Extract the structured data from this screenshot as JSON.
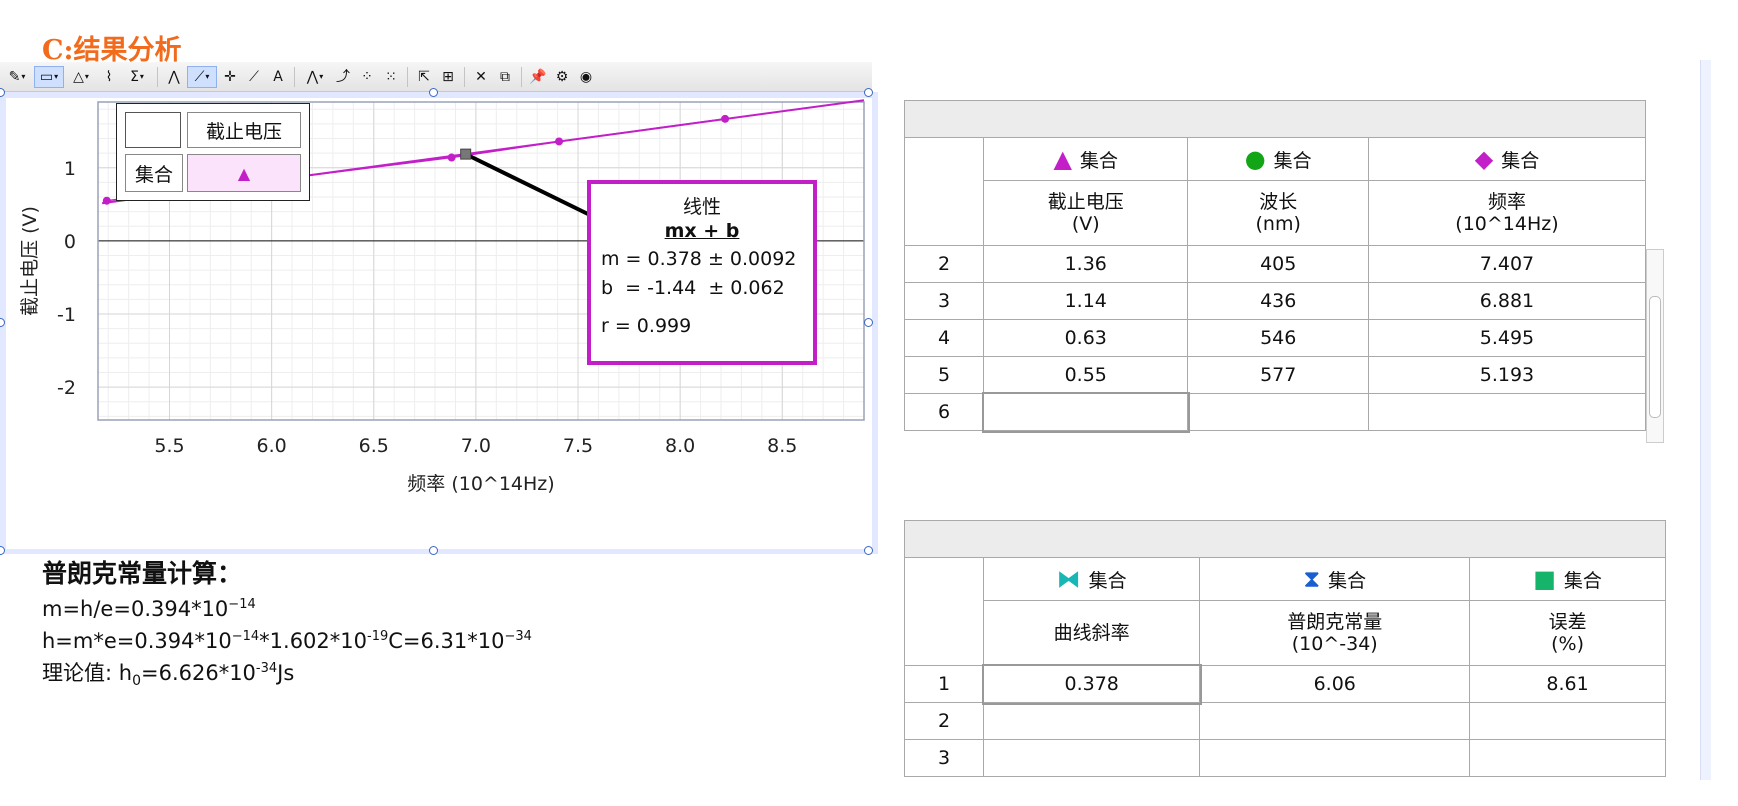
{
  "section_title": "C:结果分析",
  "toolbar": {
    "buttons": [
      {
        "name": "table-options-icon",
        "glyph": "✎",
        "dropdown": true
      },
      {
        "name": "insert-icon",
        "glyph": "▭",
        "dropdown": true,
        "active": true
      },
      {
        "name": "graph-options-icon",
        "glyph": "△",
        "dropdown": true
      },
      {
        "name": "statistics-icon",
        "glyph": "⌇",
        "dropdown": false
      },
      {
        "name": "sigma-icon",
        "glyph": "Σ",
        "dropdown": true
      },
      {
        "name": "integral-icon",
        "glyph": "⋀",
        "dropdown": false
      },
      {
        "name": "linear-fit-icon",
        "glyph": "⟋",
        "dropdown": true,
        "active": true
      },
      {
        "name": "examine-icon",
        "glyph": "✛",
        "dropdown": false
      },
      {
        "name": "tangent-icon",
        "glyph": "⟋",
        "dropdown": false
      },
      {
        "name": "annotation-icon",
        "glyph": "A",
        "dropdown": false
      },
      {
        "name": "fft-icon",
        "glyph": "⋀",
        "dropdown": true
      },
      {
        "name": "curve-fit-icon",
        "glyph": "⤴",
        "dropdown": false
      },
      {
        "name": "connect-points-icon",
        "glyph": "⁘",
        "dropdown": false
      },
      {
        "name": "disconnect-points-icon",
        "glyph": "⁙",
        "dropdown": false
      },
      {
        "name": "autoscale-icon",
        "glyph": "⇱",
        "dropdown": false
      },
      {
        "name": "zoom-icon",
        "glyph": "⊞",
        "dropdown": false
      },
      {
        "name": "delete-icon",
        "glyph": "✕",
        "dropdown": false
      },
      {
        "name": "copy-icon",
        "glyph": "⧉",
        "dropdown": false
      },
      {
        "name": "pin-icon",
        "glyph": "📌",
        "dropdown": false
      },
      {
        "name": "settings-icon",
        "glyph": "⚙",
        "dropdown": false
      },
      {
        "name": "view-icon",
        "glyph": "◉",
        "dropdown": false
      }
    ]
  },
  "colors": {
    "accent_title": "#f26a1b",
    "series": "#c21fc9",
    "fit_border": "#c21fc9",
    "selection": "#3a67c8"
  },
  "chart_data": {
    "type": "scatter",
    "xlabel": "频率 (10^14Hz)",
    "ylabel": "截止电压 (V)",
    "xlim": [
      5.15,
      8.9
    ],
    "ylim": [
      -2.45,
      1.9
    ],
    "xticks": [
      "5.5",
      "6.0",
      "6.5",
      "7.0",
      "7.5",
      "8.0",
      "8.5"
    ],
    "xtick_values": [
      5.5,
      6.0,
      6.5,
      7.0,
      7.5,
      8.0,
      8.5
    ],
    "yticks": [
      "1",
      "0",
      "-1",
      "-2"
    ],
    "ytick_values": [
      1,
      0,
      -1,
      -2
    ],
    "grid": true,
    "series": [
      {
        "name": "集合",
        "x": [
          8.22,
          7.407,
          6.881,
          5.193
        ],
        "y": [
          1.67,
          1.36,
          1.14,
          0.55
        ],
        "marker": "circle"
      }
    ],
    "fit": {
      "m": 0.378,
      "b": -1.44,
      "title": "线性",
      "formula": "mx + b",
      "m_text": "m = 0.378 ± 0.0092",
      "b_text": "b  = -1.44  ± 0.062",
      "r_text": "r = 0.999",
      "examine_x": 6.95
    },
    "legend": {
      "header": "截止电压",
      "row_label": "集合",
      "symbol": "▲",
      "position": "top-left"
    }
  },
  "calc": {
    "heading": "普朗克常量计算：",
    "line1_prefix": "m=h/e=0.394*10",
    "line1_sup": "−14",
    "line2_a": "h=m*e=0.394*10",
    "line2_sup1": "−14",
    "line2_b": "*1.602*10",
    "line2_sup2": "-19",
    "line2_c": "C=6.31*10",
    "line2_sup3": "−34",
    "line3_a": "理论值: h",
    "line3_sub": "0",
    "line3_b": "=6.626*10",
    "line3_sup": "-34",
    "line3_c": "Js"
  },
  "table1": {
    "columns": [
      {
        "symbol": "▲",
        "symbol_color": "#c21fc9",
        "set": "集合",
        "name": "截止电压",
        "unit": "(V)"
      },
      {
        "symbol": "●",
        "symbol_color": "#12a516",
        "set": "集合",
        "name": "波长",
        "unit": "(nm)"
      },
      {
        "symbol": "◆",
        "symbol_color": "#c21fc9",
        "set": "集合",
        "name": "频率",
        "unit": "(10^14Hz)"
      }
    ],
    "rows": [
      {
        "idx": "2",
        "c1": "1.36",
        "c2": "405",
        "c3": "7.407"
      },
      {
        "idx": "3",
        "c1": "1.14",
        "c2": "436",
        "c3": "6.881"
      },
      {
        "idx": "4",
        "c1": "0.63",
        "c2": "546",
        "c3": "5.495"
      },
      {
        "idx": "5",
        "c1": "0.55",
        "c2": "577",
        "c3": "5.193"
      },
      {
        "idx": "6",
        "c1": "",
        "c2": "",
        "c3": ""
      }
    ]
  },
  "table2": {
    "columns": [
      {
        "symbol": "⧓",
        "symbol_color": "#19b6b6",
        "set": "集合",
        "name": "曲线斜率",
        "unit": ""
      },
      {
        "symbol": "⧗",
        "symbol_color": "#1a5fd1",
        "set": "集合",
        "name": "普朗克常量",
        "unit": "(10^-34)"
      },
      {
        "symbol": "■",
        "symbol_color": "#16b36b",
        "set": "集合",
        "name": "误差",
        "unit": "(%)"
      }
    ],
    "rows": [
      {
        "idx": "1",
        "c1": "0.378",
        "c2": "6.06",
        "c3": "8.61"
      },
      {
        "idx": "2",
        "c1": "",
        "c2": "",
        "c3": ""
      },
      {
        "idx": "3",
        "c1": "",
        "c2": "",
        "c3": ""
      }
    ]
  }
}
